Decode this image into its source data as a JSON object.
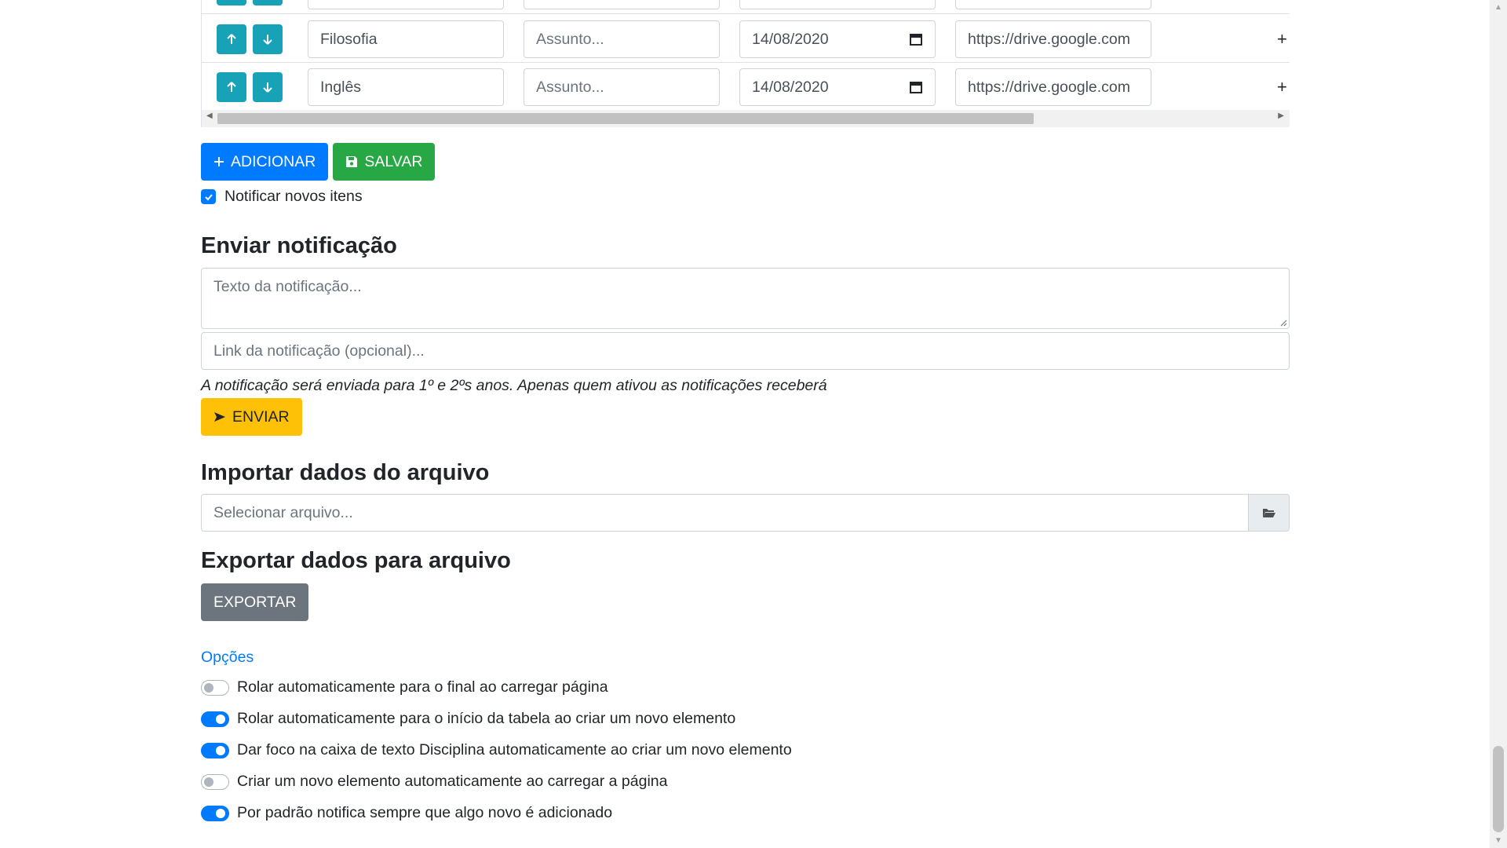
{
  "table": {
    "rows": [
      {
        "discipline": "Filosofia",
        "subject_placeholder": "Assunto...",
        "date": "14/08/2020",
        "link": "https://drive.google.com"
      },
      {
        "discipline": "Inglês",
        "subject_placeholder": "Assunto...",
        "date": "14/08/2020",
        "link": "https://drive.google.com"
      }
    ]
  },
  "actions": {
    "add_label": "ADICIONAR",
    "save_label": "SALVAR",
    "notify_label": "Notificar novos itens",
    "notify_checked": true
  },
  "notification": {
    "title": "Enviar notificação",
    "text_placeholder": "Texto da notificação...",
    "link_placeholder": "Link da notificação (opcional)...",
    "help": "A notificação será enviada para 1º e 2ºs anos. Apenas quem ativou as notificações receberá",
    "send_label": "ENVIAR"
  },
  "import": {
    "title": "Importar dados do arquivo",
    "file_placeholder": "Selecionar arquivo..."
  },
  "export": {
    "title": "Exportar dados para arquivo",
    "button_label": "EXPORTAR"
  },
  "options": {
    "link_label": "Opções",
    "items": [
      {
        "label": "Rolar automaticamente para o final ao carregar página",
        "on": false
      },
      {
        "label": "Rolar automaticamente para o início da tabela ao criar um novo elemento",
        "on": true
      },
      {
        "label": "Dar foco na caixa de texto Disciplina automaticamente ao criar um novo elemento",
        "on": true
      },
      {
        "label": "Criar um novo elemento automaticamente ao carregar a página",
        "on": false
      },
      {
        "label": "Por padrão notifica sempre que algo novo é adicionado",
        "on": true
      }
    ]
  },
  "colors": {
    "primary": "#007bff",
    "success": "#28a745",
    "warning": "#ffc107",
    "info": "#17a2b8",
    "secondary": "#6c757d"
  }
}
